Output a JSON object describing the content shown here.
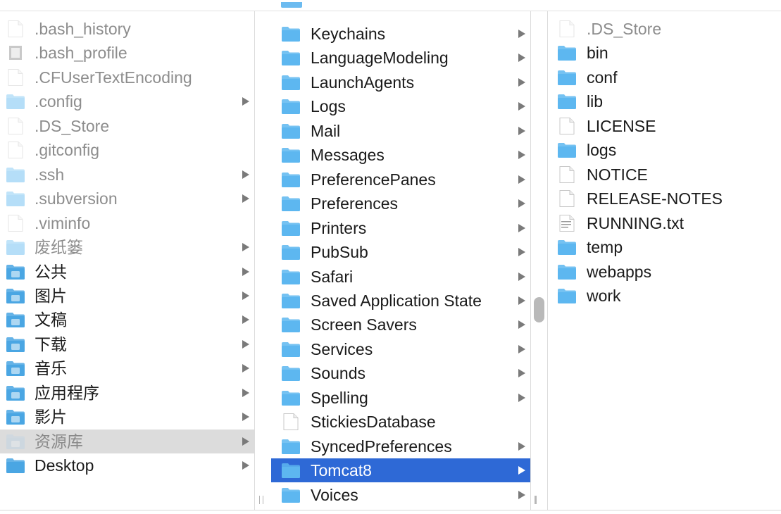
{
  "colors": {
    "selection": "#2e69d6",
    "parent_highlight": "#dcdcdc",
    "folder_blue": "#5db7f0",
    "hidden_text": "#8d8d8d"
  },
  "column_user_home": {
    "items": [
      {
        "label": ".bash_history",
        "icon": "document-icon",
        "hidden": true,
        "has_children": false
      },
      {
        "label": ".bash_profile",
        "icon": "executable-file-icon",
        "hidden": true,
        "has_children": false
      },
      {
        "label": ".CFUserTextEncoding",
        "icon": "document-icon",
        "hidden": true,
        "has_children": false
      },
      {
        "label": ".config",
        "icon": "folder-icon",
        "hidden": true,
        "has_children": true
      },
      {
        "label": ".DS_Store",
        "icon": "document-icon",
        "hidden": true,
        "has_children": false
      },
      {
        "label": ".gitconfig",
        "icon": "document-icon",
        "hidden": true,
        "has_children": false
      },
      {
        "label": ".ssh",
        "icon": "folder-icon",
        "hidden": true,
        "has_children": true
      },
      {
        "label": ".subversion",
        "icon": "folder-icon",
        "hidden": true,
        "has_children": true
      },
      {
        "label": ".viminfo",
        "icon": "document-icon",
        "hidden": true,
        "has_children": false
      },
      {
        "label": "废纸篓",
        "icon": "folder-icon",
        "hidden": true,
        "has_children": true
      },
      {
        "label": "公共",
        "icon": "public-folder-icon",
        "hidden": false,
        "has_children": true
      },
      {
        "label": "图片",
        "icon": "pictures-folder-icon",
        "hidden": false,
        "has_children": true
      },
      {
        "label": "文稿",
        "icon": "documents-folder-icon",
        "hidden": false,
        "has_children": true
      },
      {
        "label": "下载",
        "icon": "downloads-folder-icon",
        "hidden": false,
        "has_children": true
      },
      {
        "label": "音乐",
        "icon": "music-folder-icon",
        "hidden": false,
        "has_children": true
      },
      {
        "label": "应用程序",
        "icon": "applications-folder-icon",
        "hidden": false,
        "has_children": true
      },
      {
        "label": "影片",
        "icon": "movies-folder-icon",
        "hidden": false,
        "has_children": true
      },
      {
        "label": "资源库",
        "icon": "library-folder-icon",
        "hidden": true,
        "has_children": true,
        "state": "parent-of-selection"
      },
      {
        "label": "Desktop",
        "icon": "desktop-folder-icon",
        "hidden": false,
        "has_children": true
      }
    ]
  },
  "column_library": {
    "items": [
      {
        "label": "Keychains",
        "icon": "folder-icon",
        "has_children": true
      },
      {
        "label": "LanguageModeling",
        "icon": "folder-icon",
        "has_children": true
      },
      {
        "label": "LaunchAgents",
        "icon": "folder-icon",
        "has_children": true
      },
      {
        "label": "Logs",
        "icon": "folder-icon",
        "has_children": true
      },
      {
        "label": "Mail",
        "icon": "folder-icon",
        "has_children": true
      },
      {
        "label": "Messages",
        "icon": "folder-icon",
        "has_children": true
      },
      {
        "label": "PreferencePanes",
        "icon": "folder-icon",
        "has_children": true
      },
      {
        "label": "Preferences",
        "icon": "folder-icon",
        "has_children": true
      },
      {
        "label": "Printers",
        "icon": "folder-icon",
        "has_children": true
      },
      {
        "label": "PubSub",
        "icon": "folder-icon",
        "has_children": true
      },
      {
        "label": "Safari",
        "icon": "folder-icon",
        "has_children": true
      },
      {
        "label": "Saved Application State",
        "icon": "folder-icon",
        "has_children": true
      },
      {
        "label": "Screen Savers",
        "icon": "folder-icon",
        "has_children": true
      },
      {
        "label": "Services",
        "icon": "folder-icon",
        "has_children": true
      },
      {
        "label": "Sounds",
        "icon": "folder-icon",
        "has_children": true
      },
      {
        "label": "Spelling",
        "icon": "folder-icon",
        "has_children": true
      },
      {
        "label": "StickiesDatabase",
        "icon": "document-icon",
        "has_children": false
      },
      {
        "label": "SyncedPreferences",
        "icon": "folder-icon",
        "has_children": true
      },
      {
        "label": "Tomcat8",
        "icon": "folder-icon",
        "has_children": true,
        "state": "selected"
      },
      {
        "label": "Voices",
        "icon": "folder-icon",
        "has_children": true
      }
    ]
  },
  "column_tomcat": {
    "items": [
      {
        "label": ".DS_Store",
        "icon": "document-icon",
        "hidden": true
      },
      {
        "label": "bin",
        "icon": "folder-icon",
        "hidden": false
      },
      {
        "label": "conf",
        "icon": "folder-icon",
        "hidden": false
      },
      {
        "label": "lib",
        "icon": "folder-icon",
        "hidden": false
      },
      {
        "label": "LICENSE",
        "icon": "document-icon",
        "hidden": false
      },
      {
        "label": "logs",
        "icon": "folder-icon",
        "hidden": false
      },
      {
        "label": "NOTICE",
        "icon": "document-icon",
        "hidden": false
      },
      {
        "label": "RELEASE-NOTES",
        "icon": "document-icon",
        "hidden": false
      },
      {
        "label": "RUNNING.txt",
        "icon": "text-file-icon",
        "hidden": false
      },
      {
        "label": "temp",
        "icon": "folder-icon",
        "hidden": false
      },
      {
        "label": "webapps",
        "icon": "folder-icon",
        "hidden": false
      },
      {
        "label": "work",
        "icon": "folder-icon",
        "hidden": false
      }
    ]
  }
}
